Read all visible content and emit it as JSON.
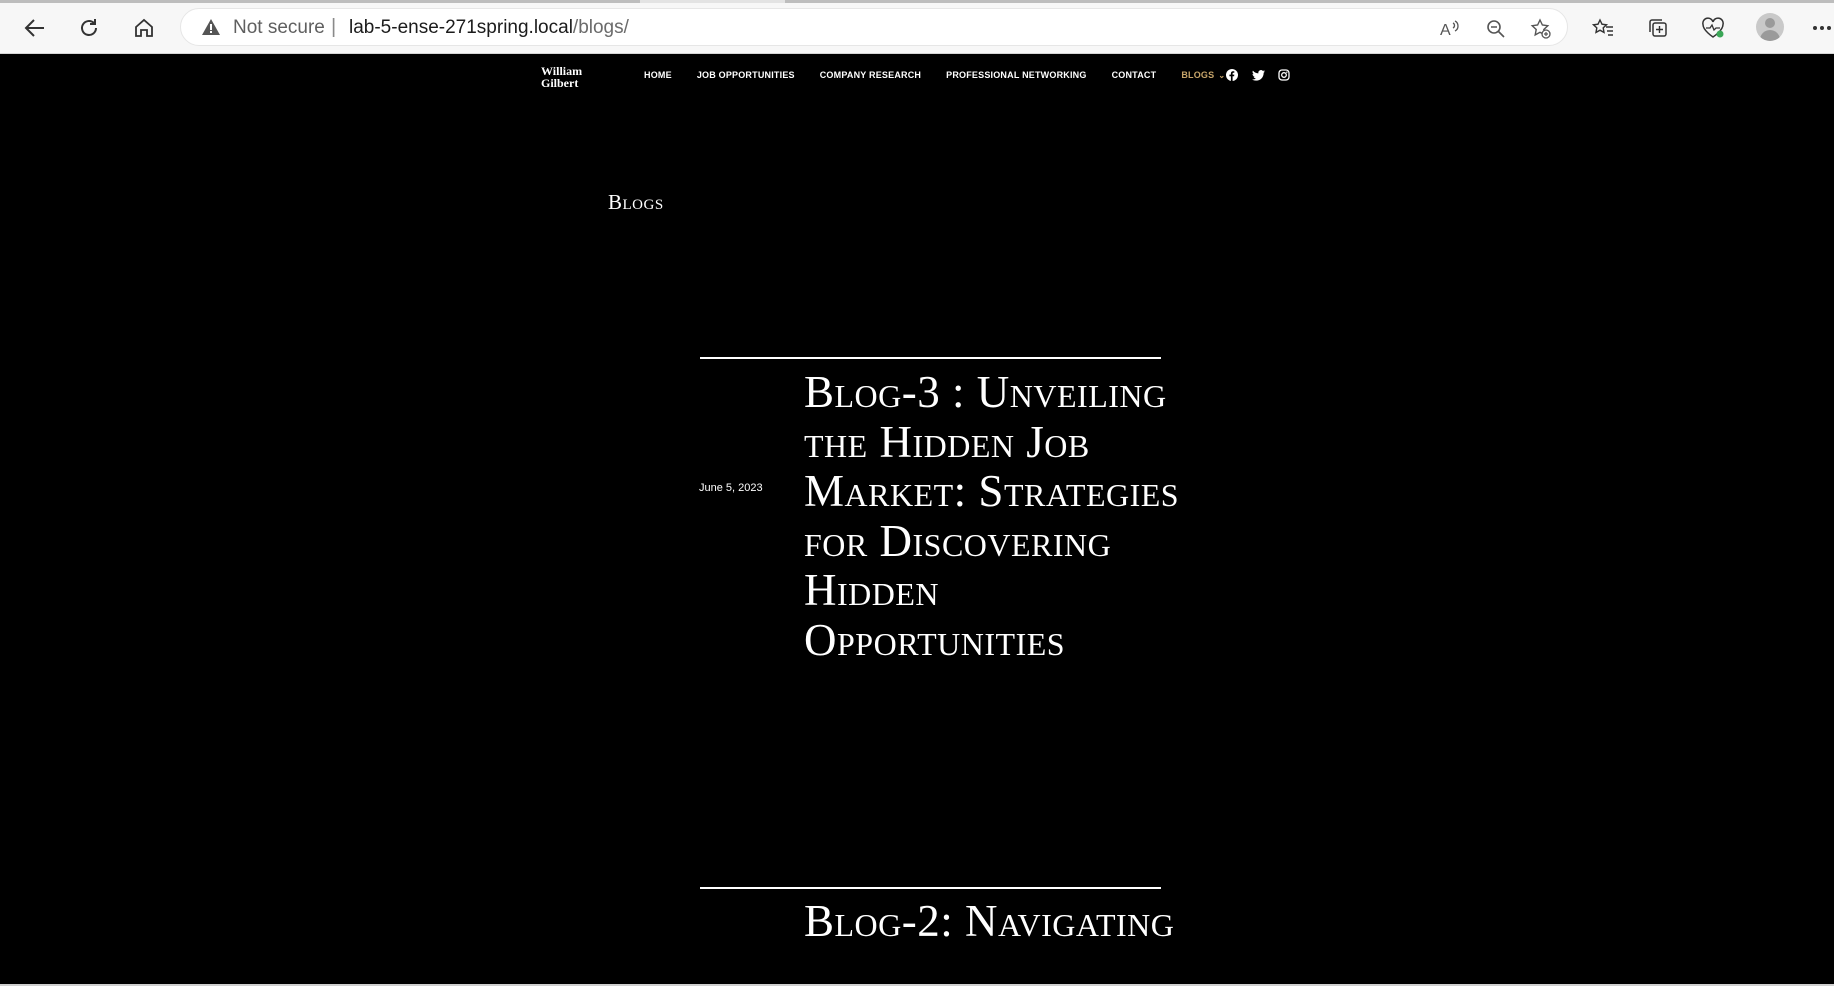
{
  "browser": {
    "security_label": "Not secure",
    "separator": "|",
    "url_host": "lab-5-ense-271spring.local",
    "url_path": "/blogs/"
  },
  "site": {
    "logo_line1": "William",
    "logo_line2": "Gilbert",
    "nav": [
      "HOME",
      "JOB OPPORTUNITIES",
      "COMPANY RESEARCH",
      "PROFESSIONAL NETWORKING",
      "CONTACT",
      "BLOGS"
    ],
    "nav_active": "BLOGS",
    "accent_color": "#c7a56a",
    "social_icons": [
      "facebook-icon",
      "twitter-icon",
      "instagram-icon"
    ]
  },
  "page": {
    "title": "Blogs"
  },
  "posts": [
    {
      "date": "June 5, 2023",
      "title": "Blog-3 : Unveiling the Hidden Job Market: Strategies for Discovering Hidden Opportunities"
    },
    {
      "date": "",
      "title": "Blog-2: Navigating"
    }
  ]
}
